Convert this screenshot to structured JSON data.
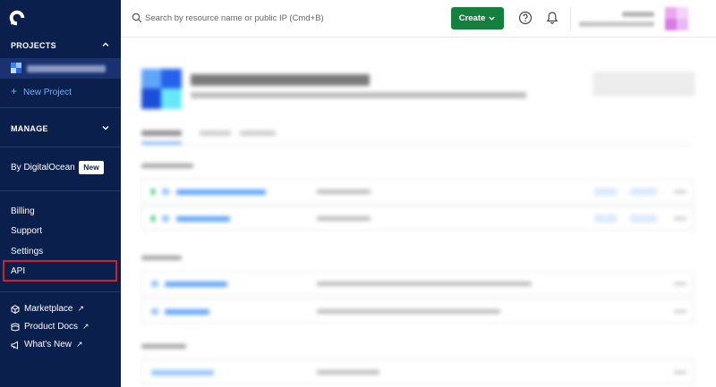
{
  "sidebar": {
    "projects_header": "PROJECTS",
    "new_project_label": "New Project",
    "manage_header": "MANAGE",
    "by_do_label": "By DigitalOcean",
    "new_badge": "New",
    "nav": {
      "billing": "Billing",
      "support": "Support",
      "settings": "Settings",
      "api": "API"
    },
    "external": {
      "marketplace": "Marketplace",
      "product_docs": "Product Docs",
      "whats_new": "What's New"
    }
  },
  "topbar": {
    "search_placeholder": "Search by resource name or public IP (Cmd+B)",
    "create_label": "Create"
  },
  "colors": {
    "sidebar_bg": "#0b1f4d",
    "accent_blue": "#64b5ff",
    "create_green": "#15803d",
    "highlight_red": "#d11f2e"
  },
  "icons": [
    "digitalocean-logo-icon",
    "search-icon",
    "help-icon",
    "bell-icon",
    "chevron-up-icon",
    "chevron-down-icon",
    "cube-icon",
    "book-icon",
    "megaphone-icon"
  ]
}
